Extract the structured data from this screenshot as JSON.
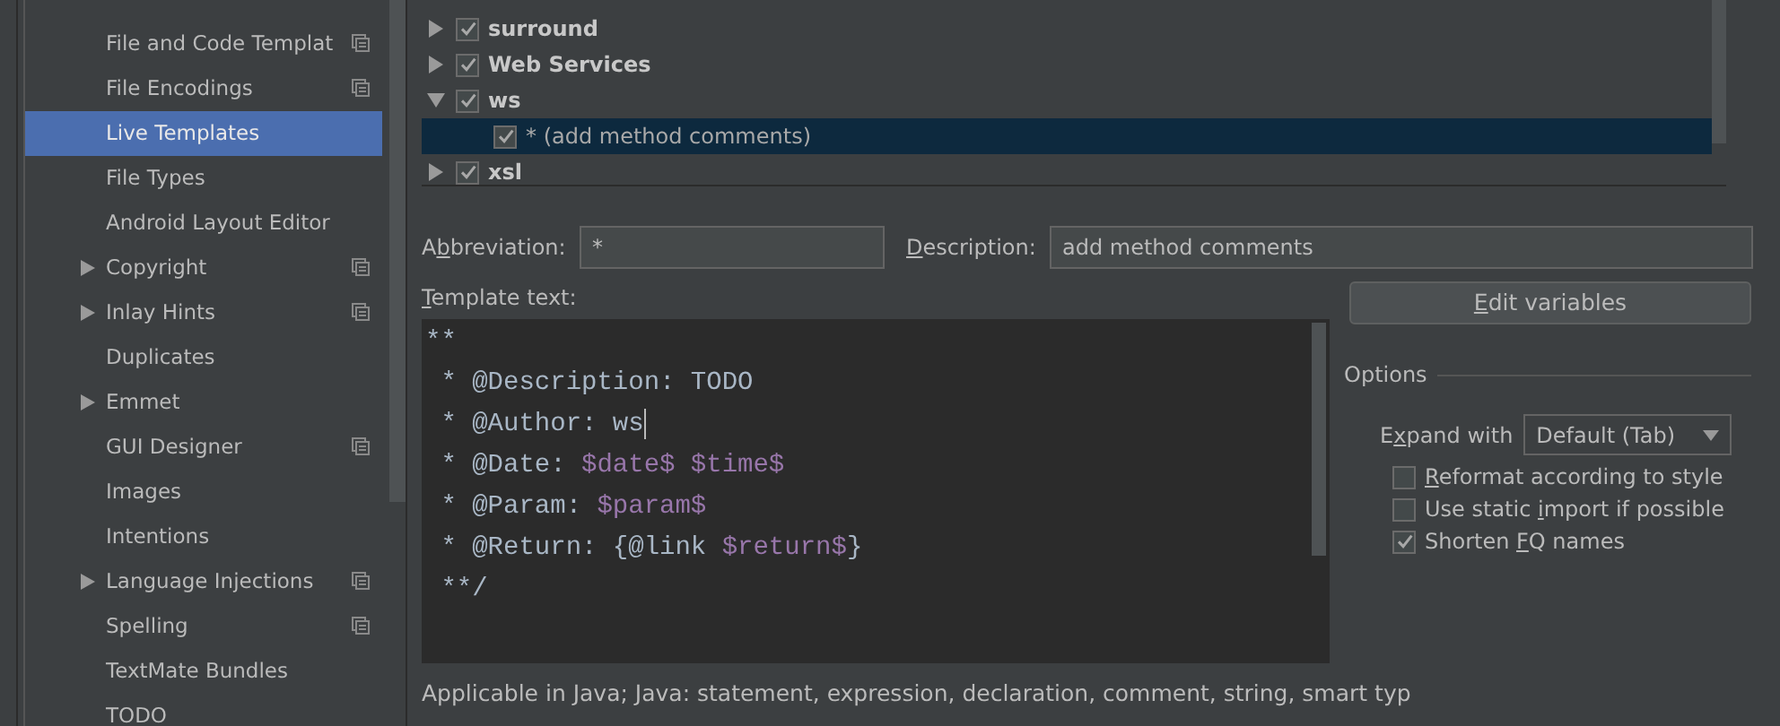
{
  "sidebar": {
    "items": [
      {
        "label": "File and Code Templat",
        "expandable": false,
        "shared": true,
        "selected": false
      },
      {
        "label": "File Encodings",
        "expandable": false,
        "shared": true,
        "selected": false
      },
      {
        "label": "Live Templates",
        "expandable": false,
        "shared": false,
        "selected": true
      },
      {
        "label": "File Types",
        "expandable": false,
        "shared": false,
        "selected": false
      },
      {
        "label": "Android Layout Editor",
        "expandable": false,
        "shared": false,
        "selected": false
      },
      {
        "label": "Copyright",
        "expandable": true,
        "shared": true,
        "selected": false
      },
      {
        "label": "Inlay Hints",
        "expandable": true,
        "shared": true,
        "selected": false
      },
      {
        "label": "Duplicates",
        "expandable": false,
        "shared": false,
        "selected": false
      },
      {
        "label": "Emmet",
        "expandable": true,
        "shared": false,
        "selected": false
      },
      {
        "label": "GUI Designer",
        "expandable": false,
        "shared": true,
        "selected": false
      },
      {
        "label": "Images",
        "expandable": false,
        "shared": false,
        "selected": false
      },
      {
        "label": "Intentions",
        "expandable": false,
        "shared": false,
        "selected": false
      },
      {
        "label": "Language Injections",
        "expandable": true,
        "shared": true,
        "selected": false
      },
      {
        "label": "Spelling",
        "expandable": false,
        "shared": true,
        "selected": false
      },
      {
        "label": "TextMate Bundles",
        "expandable": false,
        "shared": false,
        "selected": false
      },
      {
        "label": "TODO",
        "expandable": false,
        "shared": false,
        "selected": false
      }
    ]
  },
  "tree": {
    "rows": [
      {
        "label": "surround",
        "expanded": false,
        "checked": true,
        "selected": false
      },
      {
        "label": "Web Services",
        "expanded": false,
        "checked": true,
        "selected": false
      },
      {
        "label": "ws",
        "expanded": true,
        "checked": true,
        "selected": false,
        "children": [
          {
            "label": "* (add method comments)",
            "checked": true,
            "selected": true
          }
        ]
      },
      {
        "label": "xsl",
        "expanded": false,
        "checked": true,
        "selected": false
      }
    ]
  },
  "abbreviation": {
    "label": {
      "before": "A",
      "key": "b",
      "after": "breviation:"
    },
    "value": "*"
  },
  "description": {
    "label": {
      "key": "D",
      "after": "escription:"
    },
    "value": "add method comments"
  },
  "template_text": {
    "label": {
      "key": "T",
      "after": "emplate text:"
    },
    "lines": [
      {
        "caret": false,
        "segments": [
          {
            "kind": "text",
            "text": "**"
          }
        ]
      },
      {
        "caret": false,
        "segments": [
          {
            "kind": "text",
            "text": " * @Description: TODO"
          }
        ]
      },
      {
        "caret": true,
        "segments": [
          {
            "kind": "text",
            "text": " * @Author: ws"
          }
        ]
      },
      {
        "caret": false,
        "segments": [
          {
            "kind": "text",
            "text": " * @Date: "
          },
          {
            "kind": "variable",
            "text": "$date$ $time$"
          }
        ]
      },
      {
        "caret": false,
        "segments": [
          {
            "kind": "text",
            "text": " * @Param: "
          },
          {
            "kind": "variable",
            "text": "$param$"
          }
        ]
      },
      {
        "caret": false,
        "segments": [
          {
            "kind": "text",
            "text": " * @Return: {@link "
          },
          {
            "kind": "variable",
            "text": "$return$"
          },
          {
            "kind": "text",
            "text": "}"
          }
        ]
      },
      {
        "caret": false,
        "segments": [
          {
            "kind": "text",
            "text": " **/"
          }
        ]
      }
    ]
  },
  "edit_variables_button": {
    "label": {
      "key": "E",
      "after": "dit variables"
    }
  },
  "options": {
    "title": "Options",
    "expand_with": {
      "label": {
        "before": "E",
        "key": "x",
        "after": "pand with"
      },
      "value": "Default (Tab)"
    },
    "checkboxes": [
      {
        "label": {
          "key": "R",
          "after": "eformat according to style"
        },
        "checked": false
      },
      {
        "label": {
          "before": "Use static ",
          "key": "i",
          "after": "mport if possible"
        },
        "checked": false
      },
      {
        "label": {
          "before": "Shorten ",
          "key": "F",
          "after": "Q names"
        },
        "checked": true
      }
    ]
  },
  "applicable": "Applicable in Java; Java: statement, expression, declaration, comment, string, smart typ"
}
